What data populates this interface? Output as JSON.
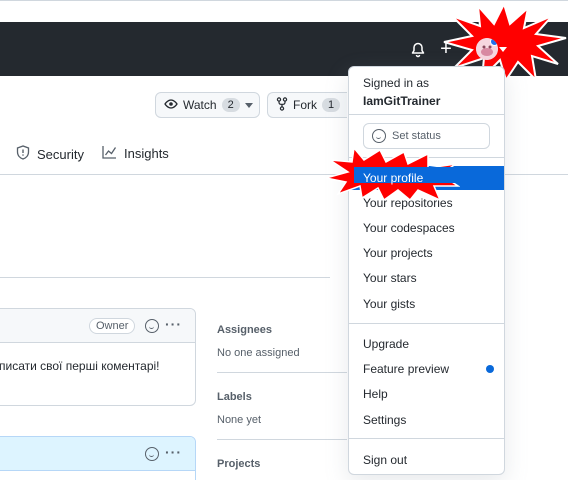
{
  "header": {
    "notifications_icon": "bell-icon",
    "create_icon": "plus-icon",
    "avatar_icon": "avatar-icon"
  },
  "repo_actions": {
    "watch_label": "Watch",
    "watch_count": "2",
    "fork_label": "Fork",
    "fork_count": "1"
  },
  "repo_nav": {
    "items": [
      {
        "label": "Security",
        "icon": "shield-icon"
      },
      {
        "label": "Insights",
        "icon": "graph-icon"
      }
    ]
  },
  "comment": {
    "badge": "Owner",
    "body": "писати свої перші коментарі!"
  },
  "sidebar": {
    "assignees_label": "Assignees",
    "assignees_value": "No one assigned",
    "labels_label": "Labels",
    "labels_value": "None yet",
    "projects_label": "Projects"
  },
  "dropdown": {
    "signed_in_as": "Signed in as",
    "username": "IamGitTrainer",
    "set_status": "Set status",
    "items": [
      {
        "label": "Your profile",
        "active": true
      },
      {
        "label": "Your repositories"
      },
      {
        "label": "Your codespaces"
      },
      {
        "label": "Your projects"
      },
      {
        "label": "Your stars"
      },
      {
        "label": "Your gists"
      },
      {
        "label": "Upgrade"
      },
      {
        "label": "Feature preview"
      },
      {
        "label": "Help"
      },
      {
        "label": "Settings"
      },
      {
        "label": "Sign out"
      }
    ]
  },
  "colors": {
    "header_bg": "#24292f",
    "accent": "#0969da",
    "highlight": "#ff0000"
  }
}
